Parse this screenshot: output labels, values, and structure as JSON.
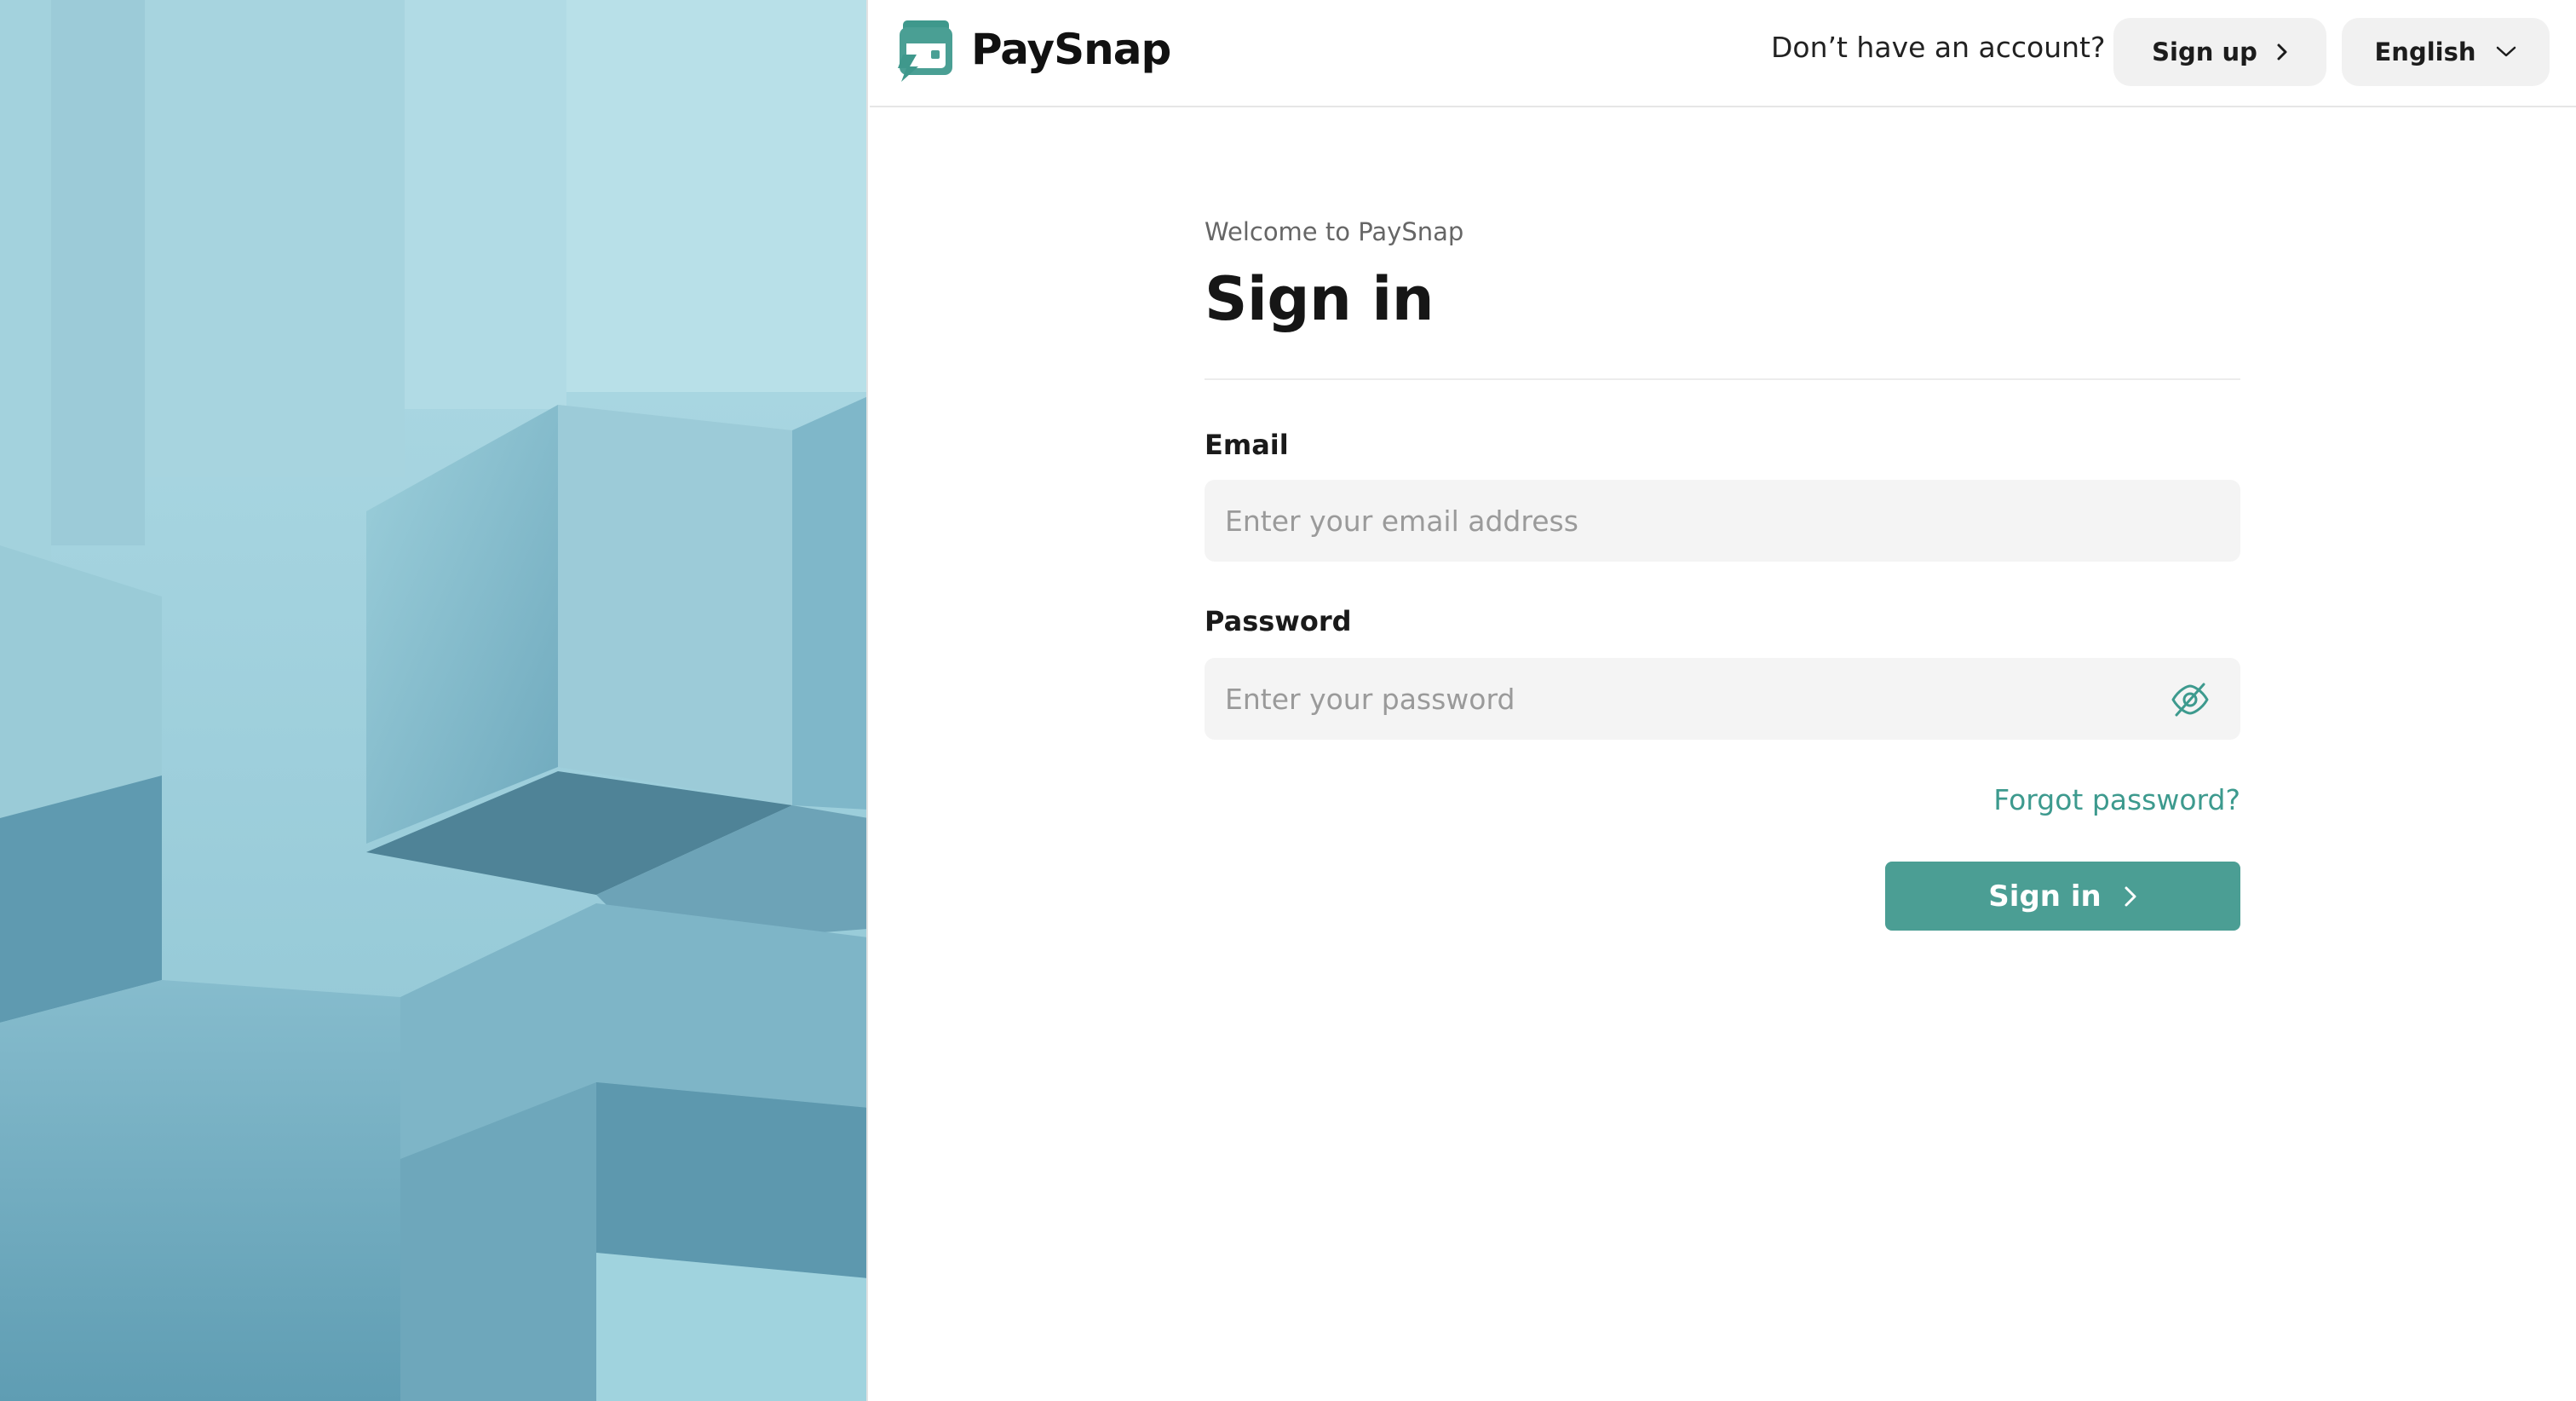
{
  "brand": {
    "name": "PaySnap",
    "accent_color": "#4b9e94",
    "logo_icon": "chat-bubble-lightning-icon"
  },
  "header": {
    "no_account_text": "Don’t have an account?",
    "signup_label": "Sign up",
    "language_label": "English"
  },
  "form": {
    "welcome": "Welcome to PaySnap",
    "title": "Sign in",
    "email": {
      "label": "Email",
      "placeholder": "Enter your email address",
      "value": ""
    },
    "password": {
      "label": "Password",
      "placeholder": "Enter your password",
      "value": "",
      "toggle_icon": "eye-off-icon"
    },
    "forgot_label": "Forgot password?",
    "submit_label": "Sign in"
  },
  "illustration": {
    "description_icon": "abstract-blocks-illustration",
    "base_color": "#a9d8e2"
  }
}
